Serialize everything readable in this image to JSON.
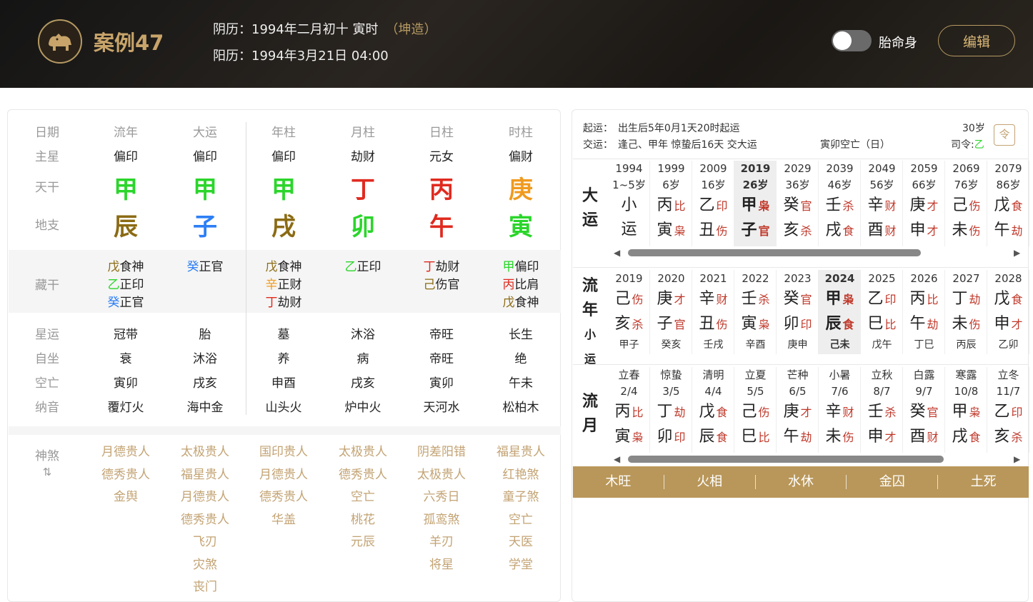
{
  "header": {
    "title": "案例47",
    "lunar": "阴历：1994年二月初十 寅时",
    "sex": "（坤造）",
    "solar": "阳历：1994年3月21日 04:00",
    "toggle_label": "胎命身",
    "edit_label": "编辑"
  },
  "colors": {
    "wood": "#2bd52b",
    "fire": "#e02a1f",
    "earth": "#8b6b14",
    "water": "#2d7ff5",
    "metal": "#f09a1e",
    "accent": "#b9975a"
  },
  "pillars": {
    "headers": [
      "日期",
      "流年",
      "大运",
      "年柱",
      "月柱",
      "日柱",
      "时柱"
    ],
    "row_labels": [
      "主星",
      "天干",
      "地支",
      "藏干",
      "星运",
      "自坐",
      "空亡",
      "纳音",
      "神煞"
    ],
    "main_star": [
      "偏印",
      "偏印",
      "偏印",
      "劫财",
      "元女",
      "偏财"
    ],
    "stems": [
      {
        "c": "甲",
        "e": "wood"
      },
      {
        "c": "甲",
        "e": "wood"
      },
      {
        "c": "甲",
        "e": "wood"
      },
      {
        "c": "丁",
        "e": "fire"
      },
      {
        "c": "丙",
        "e": "fire"
      },
      {
        "c": "庚",
        "e": "metal"
      }
    ],
    "branches": [
      {
        "c": "辰",
        "e": "earth"
      },
      {
        "c": "子",
        "e": "water"
      },
      {
        "c": "戌",
        "e": "earth"
      },
      {
        "c": "卯",
        "e": "wood"
      },
      {
        "c": "午",
        "e": "fire"
      },
      {
        "c": "寅",
        "e": "wood"
      }
    ],
    "hidden": [
      [
        {
          "s": "戊",
          "e": "earth",
          "g": "食神"
        },
        {
          "s": "乙",
          "e": "wood",
          "g": "正印"
        },
        {
          "s": "癸",
          "e": "water",
          "g": "正官"
        }
      ],
      [
        {
          "s": "癸",
          "e": "water",
          "g": "正官"
        }
      ],
      [
        {
          "s": "戊",
          "e": "earth",
          "g": "食神"
        },
        {
          "s": "辛",
          "e": "metal",
          "g": "正财"
        },
        {
          "s": "丁",
          "e": "fire",
          "g": "劫财"
        }
      ],
      [
        {
          "s": "乙",
          "e": "wood",
          "g": "正印"
        }
      ],
      [
        {
          "s": "丁",
          "e": "fire",
          "g": "劫财"
        },
        {
          "s": "己",
          "e": "earth",
          "g": "伤官"
        }
      ],
      [
        {
          "s": "甲",
          "e": "wood",
          "g": "偏印"
        },
        {
          "s": "丙",
          "e": "fire",
          "g": "比肩"
        },
        {
          "s": "戊",
          "e": "earth",
          "g": "食神"
        }
      ]
    ],
    "xingyun": [
      "冠带",
      "胎",
      "墓",
      "沐浴",
      "帝旺",
      "长生"
    ],
    "zizuo": [
      "衰",
      "沐浴",
      "养",
      "病",
      "帝旺",
      "绝"
    ],
    "kongwang": [
      "寅卯",
      "戌亥",
      "申酉",
      "戌亥",
      "寅卯",
      "午未"
    ],
    "nayin": [
      "覆灯火",
      "海中金",
      "山头火",
      "炉中火",
      "天河水",
      "松柏木"
    ],
    "shensha": [
      [
        "月德贵人",
        "德秀贵人",
        "金舆"
      ],
      [
        "太极贵人",
        "福星贵人",
        "月德贵人",
        "德秀贵人",
        "飞刃",
        "灾煞",
        "丧门"
      ],
      [
        "国印贵人",
        "月德贵人",
        "德秀贵人",
        "华盖"
      ],
      [
        "太极贵人",
        "德秀贵人",
        "空亡",
        "桃花",
        "元辰"
      ],
      [
        "阴差阳错",
        "太极贵人",
        "六秀日",
        "孤鸾煞",
        "羊刃",
        "将星"
      ],
      [
        "福星贵人",
        "红艳煞",
        "童子煞",
        "空亡",
        "天医",
        "学堂"
      ]
    ]
  },
  "luck": {
    "qiyun_label": "起运：",
    "qiyun": "出生后5年0月1天20时起运",
    "jiaoyun_label": "交运：",
    "jiaoyun": "逢己、甲年 惊蛰后16天 交大运",
    "kongwang": "寅卯空亡（日）",
    "age": "30岁",
    "siling_label": "司令:",
    "siling": "乙",
    "cal_icon": "令",
    "dayun_label": [
      "大",
      "运"
    ],
    "dayun": [
      {
        "y": "1994",
        "a": "1~5岁",
        "s": "小",
        "sg": "",
        "b": "运",
        "bg": ""
      },
      {
        "y": "1999",
        "a": "6岁",
        "s": "丙",
        "sg": "比",
        "b": "寅",
        "bg": "枭"
      },
      {
        "y": "2009",
        "a": "16岁",
        "s": "乙",
        "sg": "印",
        "b": "丑",
        "bg": "伤"
      },
      {
        "y": "2019",
        "a": "26岁",
        "s": "甲",
        "sg": "枭",
        "b": "子",
        "bg": "官",
        "sel": true
      },
      {
        "y": "2029",
        "a": "36岁",
        "s": "癸",
        "sg": "官",
        "b": "亥",
        "bg": "杀"
      },
      {
        "y": "2039",
        "a": "46岁",
        "s": "壬",
        "sg": "杀",
        "b": "戌",
        "bg": "食"
      },
      {
        "y": "2049",
        "a": "56岁",
        "s": "辛",
        "sg": "财",
        "b": "酉",
        "bg": "财"
      },
      {
        "y": "2059",
        "a": "66岁",
        "s": "庚",
        "sg": "才",
        "b": "申",
        "bg": "才"
      },
      {
        "y": "2069",
        "a": "76岁",
        "s": "己",
        "sg": "伤",
        "b": "未",
        "bg": "伤"
      },
      {
        "y": "2079",
        "a": "86岁",
        "s": "戊",
        "sg": "食",
        "b": "午",
        "bg": "劫"
      }
    ],
    "liunian_label": [
      "流",
      "年",
      "小运"
    ],
    "liunian": [
      {
        "y": "2019",
        "s": "己",
        "sg": "伤",
        "b": "亥",
        "bg": "杀",
        "x": "甲子"
      },
      {
        "y": "2020",
        "s": "庚",
        "sg": "才",
        "b": "子",
        "bg": "官",
        "x": "癸亥"
      },
      {
        "y": "2021",
        "s": "辛",
        "sg": "财",
        "b": "丑",
        "bg": "伤",
        "x": "壬戌"
      },
      {
        "y": "2022",
        "s": "壬",
        "sg": "杀",
        "b": "寅",
        "bg": "枭",
        "x": "辛酉"
      },
      {
        "y": "2023",
        "s": "癸",
        "sg": "官",
        "b": "卯",
        "bg": "印",
        "x": "庚申"
      },
      {
        "y": "2024",
        "s": "甲",
        "sg": "枭",
        "b": "辰",
        "bg": "食",
        "x": "己未",
        "sel": true
      },
      {
        "y": "2025",
        "s": "乙",
        "sg": "印",
        "b": "巳",
        "bg": "比",
        "x": "戊午"
      },
      {
        "y": "2026",
        "s": "丙",
        "sg": "比",
        "b": "午",
        "bg": "劫",
        "x": "丁巳"
      },
      {
        "y": "2027",
        "s": "丁",
        "sg": "劫",
        "b": "未",
        "bg": "伤",
        "x": "丙辰"
      },
      {
        "y": "2028",
        "s": "戊",
        "sg": "食",
        "b": "申",
        "bg": "才",
        "x": "乙卯"
      }
    ],
    "liuyue_label": [
      "流",
      "月"
    ],
    "liuyue": [
      {
        "t": "立春",
        "d": "2/4",
        "s": "丙",
        "sg": "比",
        "b": "寅",
        "bg": "枭"
      },
      {
        "t": "惊蛰",
        "d": "3/5",
        "s": "丁",
        "sg": "劫",
        "b": "卯",
        "bg": "印"
      },
      {
        "t": "清明",
        "d": "4/4",
        "s": "戊",
        "sg": "食",
        "b": "辰",
        "bg": "食"
      },
      {
        "t": "立夏",
        "d": "5/5",
        "s": "己",
        "sg": "伤",
        "b": "巳",
        "bg": "比"
      },
      {
        "t": "芒种",
        "d": "6/5",
        "s": "庚",
        "sg": "才",
        "b": "午",
        "bg": "劫"
      },
      {
        "t": "小暑",
        "d": "7/6",
        "s": "辛",
        "sg": "财",
        "b": "未",
        "bg": "伤"
      },
      {
        "t": "立秋",
        "d": "8/7",
        "s": "壬",
        "sg": "杀",
        "b": "申",
        "bg": "才"
      },
      {
        "t": "白露",
        "d": "9/7",
        "s": "癸",
        "sg": "官",
        "b": "酉",
        "bg": "财"
      },
      {
        "t": "寒露",
        "d": "10/8",
        "s": "甲",
        "sg": "枭",
        "b": "戌",
        "bg": "食"
      },
      {
        "t": "立冬",
        "d": "11/7",
        "s": "乙",
        "sg": "印",
        "b": "亥",
        "bg": "杀"
      }
    ],
    "wuxing": [
      "木旺",
      "火相",
      "水休",
      "金囚",
      "土死"
    ]
  }
}
